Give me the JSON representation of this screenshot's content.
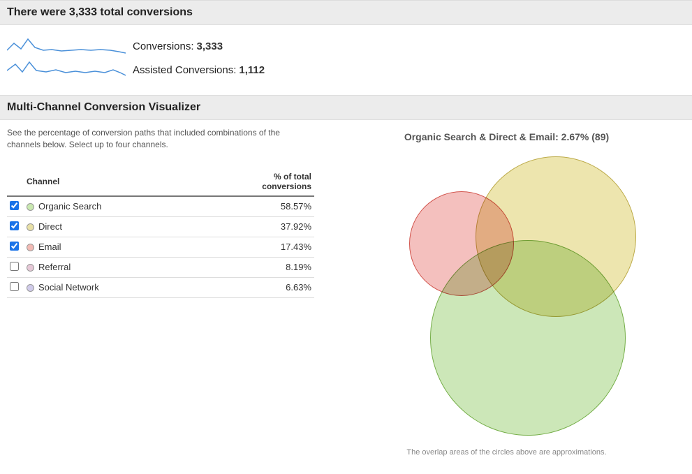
{
  "summary": {
    "heading": "There were 3,333 total conversions",
    "metrics": {
      "conversions_label": "Conversions:",
      "conversions_value": "3,333",
      "assisted_label": "Assisted Conversions:",
      "assisted_value": "1,112"
    }
  },
  "visualizer": {
    "heading": "Multi-Channel Conversion Visualizer",
    "intro": "See the percentage of conversion paths that included combinations of the channels below. Select up to four channels.",
    "table": {
      "col_channel": "Channel",
      "col_pct_line1": "% of total",
      "col_pct_line2": "conversions"
    },
    "channels": [
      {
        "name": "Organic Search",
        "pct": "58.57%",
        "checked": true,
        "color": "#c9e8b0"
      },
      {
        "name": "Direct",
        "pct": "37.92%",
        "checked": true,
        "color": "#e8e0a6"
      },
      {
        "name": "Email",
        "pct": "17.43%",
        "checked": true,
        "color": "#f2bab4"
      },
      {
        "name": "Referral",
        "pct": "8.19%",
        "checked": false,
        "color": "#e6c8d7"
      },
      {
        "name": "Social Network",
        "pct": "6.63%",
        "checked": false,
        "color": "#d0cbea"
      }
    ],
    "venn": {
      "title": "Organic Search & Direct & Email: 2.67% (89)",
      "footnote": "The overlap areas of the circles above are approximations."
    }
  },
  "chart_data": {
    "type": "venn",
    "title": "Organic Search & Direct & Email: 2.67% (89)",
    "sets": [
      {
        "name": "Organic Search",
        "pct": 58.57,
        "color": "#a3d47d"
      },
      {
        "name": "Direct",
        "pct": 37.92,
        "color": "#decf6c"
      },
      {
        "name": "Email",
        "pct": 17.43,
        "color": "#ec9692"
      }
    ],
    "intersection": {
      "sets": [
        "Organic Search",
        "Direct",
        "Email"
      ],
      "pct": 2.67,
      "count": 89
    },
    "note": "The overlap areas of the circles above are approximations."
  }
}
